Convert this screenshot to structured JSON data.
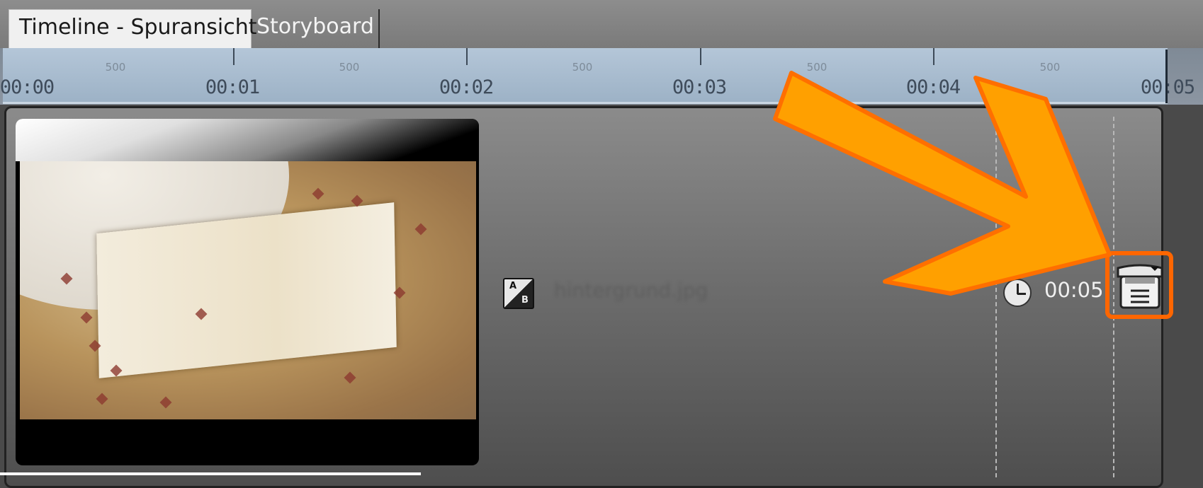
{
  "tabs": {
    "active": "Timeline - Spuransicht",
    "inactive": "Storyboard"
  },
  "ruler": {
    "time_labels": [
      "00:00",
      "00:01",
      "00:02",
      "00:03",
      "00:04",
      "00:05"
    ],
    "minor_label": "500"
  },
  "clip": {
    "filename": "hintergrund.jpg",
    "duration": "00:05",
    "transition_icon": "ab-transition-icon",
    "duration_icon": "clock-icon",
    "edit_icon": "clip-edit-icon"
  },
  "annotation": {
    "arrow_color": "#ff9900",
    "highlight_color": "#ff6600"
  }
}
